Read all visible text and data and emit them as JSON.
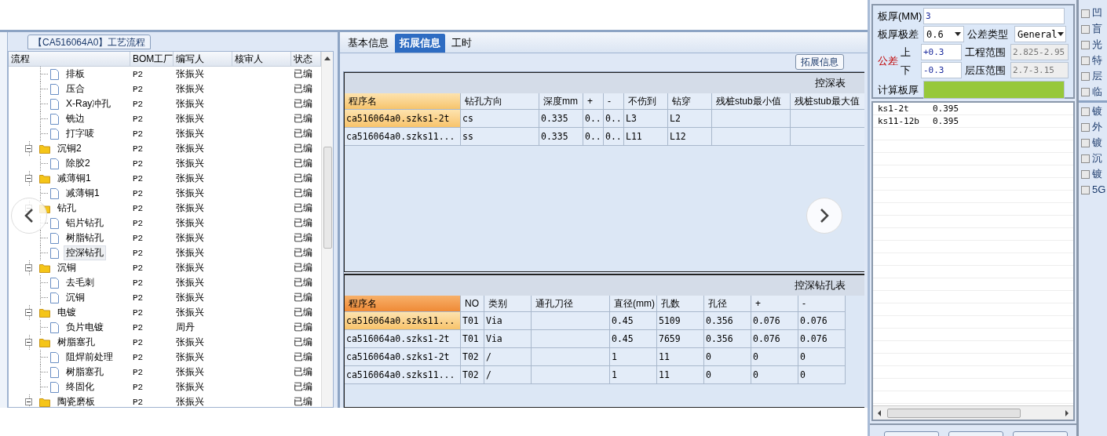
{
  "process_panel": {
    "title": "【CA516064A0】工艺流程",
    "columns": [
      "流程",
      "BOM工厂",
      "编写人",
      "核审人",
      "状态"
    ],
    "tree": [
      {
        "children": [
          {
            "kind": "file",
            "label": "排板",
            "bom": "P2",
            "author": "张振兴",
            "status": "已编",
            "selected": false
          },
          {
            "kind": "file",
            "label": "压合",
            "bom": "P2",
            "author": "张振兴",
            "status": "已编",
            "selected": false
          },
          {
            "kind": "file",
            "label": "X-Ray冲孔",
            "bom": "P2",
            "author": "张振兴",
            "status": "已编",
            "selected": false
          },
          {
            "kind": "file",
            "label": "铣边",
            "bom": "P2",
            "author": "张振兴",
            "status": "已编",
            "selected": false
          },
          {
            "kind": "file",
            "label": "打字唛",
            "bom": "P2",
            "author": "张振兴",
            "status": "已编",
            "selected": false
          }
        ]
      },
      {
        "kind": "folder",
        "label": "沉铜2",
        "expanded": true,
        "bom": "P2",
        "author": "张振兴",
        "status": "已编",
        "selected": false,
        "children": [
          {
            "kind": "file",
            "label": "除胶2",
            "bom": "P2",
            "author": "张振兴",
            "status": "已编",
            "selected": false
          }
        ]
      },
      {
        "kind": "folder",
        "label": "减薄铜1",
        "expanded": true,
        "bom": "P2",
        "author": "张振兴",
        "status": "已编",
        "selected": false,
        "children": [
          {
            "kind": "file",
            "label": "减薄铜1",
            "bom": "P2",
            "author": "张振兴",
            "status": "已编",
            "selected": false
          }
        ]
      },
      {
        "kind": "folder",
        "label": "钻孔",
        "expanded": true,
        "bom": "P2",
        "author": "张振兴",
        "status": "已编",
        "selected": false,
        "children": [
          {
            "kind": "file",
            "label": "铝片钻孔",
            "bom": "P2",
            "author": "张振兴",
            "status": "已编",
            "selected": false
          },
          {
            "kind": "file",
            "label": "树脂钻孔",
            "bom": "P2",
            "author": "张振兴",
            "status": "已编",
            "selected": false
          },
          {
            "kind": "file",
            "label": "控深钻孔",
            "bom": "P2",
            "author": "张振兴",
            "status": "已编",
            "selected": true
          }
        ]
      },
      {
        "kind": "folder",
        "label": "沉铜",
        "expanded": true,
        "bom": "P2",
        "author": "张振兴",
        "status": "已编",
        "selected": false,
        "children": [
          {
            "kind": "file",
            "label": "去毛刺",
            "bom": "P2",
            "author": "张振兴",
            "status": "已编",
            "selected": false
          },
          {
            "kind": "file",
            "label": "沉铜",
            "bom": "P2",
            "author": "张振兴",
            "status": "已编",
            "selected": false
          }
        ]
      },
      {
        "kind": "folder",
        "label": "电镀",
        "expanded": true,
        "bom": "P2",
        "author": "张振兴",
        "status": "已编",
        "selected": false,
        "children": [
          {
            "kind": "file",
            "label": "负片电镀",
            "bom": "P2",
            "author": "周丹",
            "status": "已编",
            "selected": false
          }
        ]
      },
      {
        "kind": "folder",
        "label": "树脂塞孔",
        "expanded": true,
        "bom": "P2",
        "author": "张振兴",
        "status": "已编",
        "selected": false,
        "children": [
          {
            "kind": "file",
            "label": "阻焊前处理",
            "bom": "P2",
            "author": "张振兴",
            "status": "已编",
            "selected": false
          },
          {
            "kind": "file",
            "label": "树脂塞孔",
            "bom": "P2",
            "author": "张振兴",
            "status": "已编",
            "selected": false
          },
          {
            "kind": "file",
            "label": "终固化",
            "bom": "P2",
            "author": "张振兴",
            "status": "已编",
            "selected": false
          }
        ]
      },
      {
        "kind": "folder",
        "label": "陶瓷磨板",
        "expanded": true,
        "bom": "P2",
        "author": "张振兴",
        "status": "已编",
        "selected": false
      }
    ]
  },
  "detail_tabs": [
    {
      "label": "基本信息",
      "selected": false
    },
    {
      "label": "拓展信息",
      "selected": true
    },
    {
      "label": "工时",
      "selected": false
    }
  ],
  "group_title": "拓展信息",
  "depth_table": {
    "title": "控深表",
    "columns": [
      "程序名",
      "钻孔方向",
      "深度mm",
      "+",
      "-",
      "不伤到",
      "钻穿",
      "残桩stub最小值",
      "残桩stub最大值"
    ],
    "rows": [
      {
        "cells": [
          "ca516064a0.szks1-2t",
          "cs",
          "0.335",
          "0..",
          "0..",
          "L3",
          "L2",
          "",
          ""
        ],
        "selected": true
      },
      {
        "cells": [
          "ca516064a0.szks11...",
          "ss",
          "0.335",
          "0..",
          "0..",
          "L11",
          "L12",
          "",
          ""
        ],
        "selected": false
      }
    ]
  },
  "drill_table": {
    "title": "控深钻孔表",
    "columns": [
      "程序名",
      "NO",
      "类别",
      "通孔刀径",
      "直径(mm)",
      "孔数",
      "孔径",
      "+",
      "-"
    ],
    "rows": [
      {
        "cells": [
          "ca516064a0.szks11...",
          "T01",
          "Via",
          "",
          "0.45",
          "5109",
          "0.356",
          "0.076",
          "0.076"
        ],
        "selected": true
      },
      {
        "cells": [
          "ca516064a0.szks1-2t",
          "T01",
          "Via",
          "",
          "0.45",
          "7659",
          "0.356",
          "0.076",
          "0.076"
        ],
        "selected": false
      },
      {
        "cells": [
          "ca516064a0.szks1-2t",
          "T02",
          "/",
          "",
          "1",
          "11",
          "0",
          "0",
          "0"
        ],
        "selected": false
      },
      {
        "cells": [
          "ca516064a0.szks11...",
          "T02",
          "/",
          "",
          "1",
          "11",
          "0",
          "0",
          "0"
        ],
        "selected": false
      }
    ]
  },
  "thickness_form": {
    "thickness_label": "板厚(MM)",
    "thickness": "3",
    "range_label": "板厚极差",
    "range": "0.6",
    "tol_type_label": "公差类型",
    "tol_type": "General",
    "tolerance_label": "公差",
    "upper_label": "上",
    "upper": "+0.3",
    "lower_label": "下",
    "lower": "-0.3",
    "eng_range_label": "工程范围",
    "eng_range": "2.825-2.95",
    "press_range_label": "层压范围",
    "press_range": "2.7-3.15",
    "calc_label": "计算板厚"
  },
  "thickness_list": [
    {
      "name": "ks1-2t",
      "value": "0.395"
    },
    {
      "name": "ks11-12b",
      "value": "0.395"
    }
  ],
  "options": [
    {
      "label": "凹",
      "checked": false
    },
    {
      "label": "盲",
      "checked": false
    },
    {
      "label": "光",
      "checked": false
    },
    {
      "label": "特",
      "checked": false
    },
    {
      "label": "层",
      "checked": false
    },
    {
      "label": "临",
      "checked": false
    },
    {
      "label": "镀",
      "checked": false
    },
    {
      "label": "外",
      "checked": false
    },
    {
      "label": "镀",
      "checked": false
    },
    {
      "label": "沉",
      "checked": false
    },
    {
      "label": "镀",
      "checked": false
    },
    {
      "label": "5G",
      "checked": false
    }
  ]
}
